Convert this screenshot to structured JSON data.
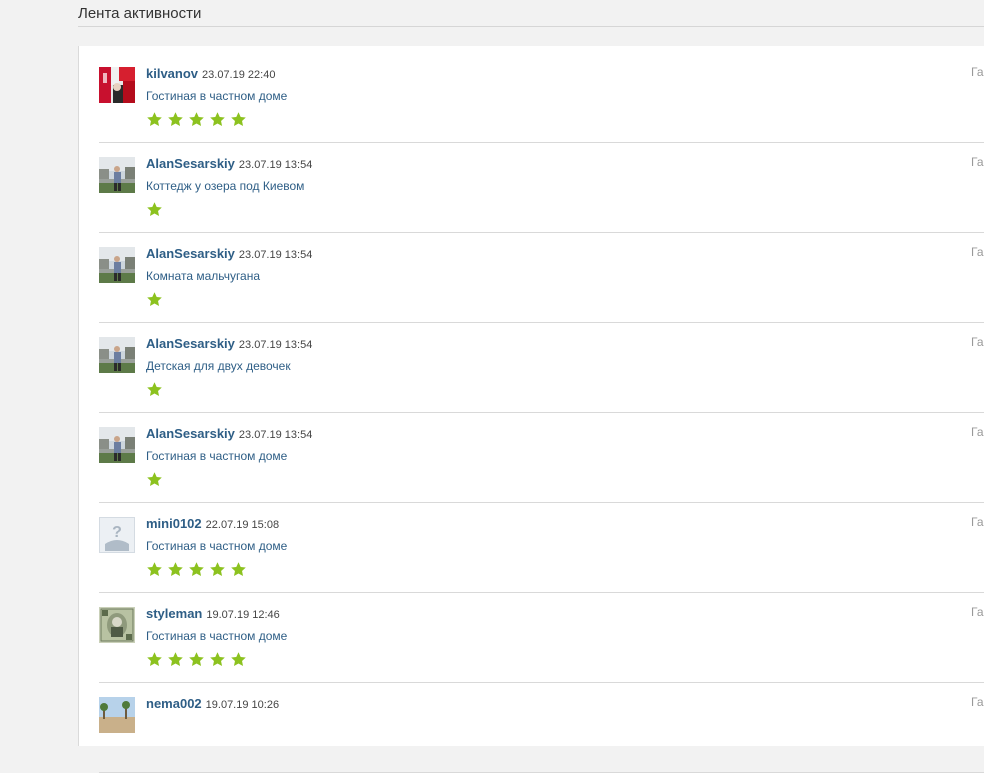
{
  "page": {
    "title": "Лента активности"
  },
  "colors": {
    "link": "#2e5e86",
    "star": "#8cc21f",
    "divider": "#d9d9d9"
  },
  "feed": [
    {
      "user": "kilvanov",
      "datetime": "23.07.19 22:40",
      "subject": "Гостиная в частном доме",
      "rating": 5,
      "avatar": "red-collage-avatar",
      "side": "Га"
    },
    {
      "user": "AlanSesarskiy",
      "datetime": "23.07.19 13:54",
      "subject": "Коттедж у озера под Киевом",
      "rating": 1,
      "avatar": "person-photo-avatar",
      "side": "Га"
    },
    {
      "user": "AlanSesarskiy",
      "datetime": "23.07.19 13:54",
      "subject": "Комната мальчугана",
      "rating": 1,
      "avatar": "person-photo-avatar",
      "side": "Га"
    },
    {
      "user": "AlanSesarskiy",
      "datetime": "23.07.19 13:54",
      "subject": "Детская для двух девочек",
      "rating": 1,
      "avatar": "person-photo-avatar",
      "side": "Га"
    },
    {
      "user": "AlanSesarskiy",
      "datetime": "23.07.19 13:54",
      "subject": "Гостиная в частном доме",
      "rating": 1,
      "avatar": "person-photo-avatar",
      "side": "Га"
    },
    {
      "user": "mini0102",
      "datetime": "22.07.19 15:08",
      "subject": "Гостиная в частном доме",
      "rating": 5,
      "avatar": "default-avatar",
      "side": "Га"
    },
    {
      "user": "styleman",
      "datetime": "19.07.19 12:46",
      "subject": "Гостиная в частном доме",
      "rating": 5,
      "avatar": "banknote-avatar",
      "side": "Га"
    },
    {
      "user": "nema002",
      "datetime": "19.07.19 10:26",
      "subject": "",
      "rating": 0,
      "avatar": "landscape-avatar",
      "side": "Га"
    }
  ]
}
